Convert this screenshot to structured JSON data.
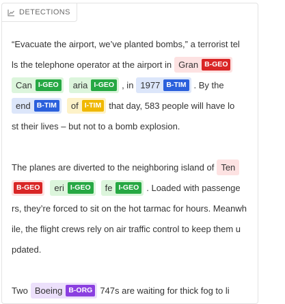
{
  "panel": {
    "tab_label": "DETECTIONS",
    "tab_icon": "chart-icon"
  },
  "colors": {
    "B-GEO": "#d92626",
    "I-GEO": "#26a843",
    "B-TIM": "#2b60dc",
    "I-TIM": "#f0b800",
    "B-ORG": "#8b3fe0"
  },
  "paragraphs": [
    {
      "lines": [
        [
          {
            "t": "“Evacuate the airport, we’ve planted bombs,” a terrorist tel"
          }
        ],
        [
          {
            "t": "ls the telephone operator at the airport in"
          },
          {
            "e": "Gran",
            "tag": "B-GEO"
          }
        ],
        [
          {
            "e": "Can",
            "tag": "I-GEO"
          },
          {
            "e": "aria",
            "tag": "I-GEO"
          },
          {
            "t": ", in"
          },
          {
            "e": "1977",
            "tag": "B-TIM"
          },
          {
            "t": ". By the"
          }
        ],
        [
          {
            "e": "end",
            "tag": "B-TIM"
          },
          {
            "e": "of",
            "tag": "I-TIM"
          },
          {
            "t": "that day, 583 people will have lo"
          }
        ],
        [
          {
            "t": "st their lives – but not to a bomb explosion."
          }
        ]
      ]
    },
    {
      "lines": [
        [
          {
            "t": "The planes are diverted to the neighboring island of"
          },
          {
            "e": "Ten",
            "tag": ""
          }
        ],
        [
          {
            "e": "",
            "tag": "B-GEO"
          },
          {
            "e": "eri",
            "tag": "I-GEO"
          },
          {
            "e": "fe",
            "tag": "I-GEO"
          },
          {
            "t": ". Loaded with passenge"
          }
        ],
        [
          {
            "t": "rs, they’re forced to sit on the hot tarmac for hours. Meanwh"
          }
        ],
        [
          {
            "t": "ile, the flight crews rely on air traffic control to keep them u"
          }
        ],
        [
          {
            "t": "pdated."
          }
        ]
      ]
    },
    {
      "lines": [
        [
          {
            "t": "Two"
          },
          {
            "e": "Boeing",
            "tag": "B-ORG"
          },
          {
            "t": "747s are waiting for thick fog to li"
          }
        ]
      ]
    }
  ]
}
